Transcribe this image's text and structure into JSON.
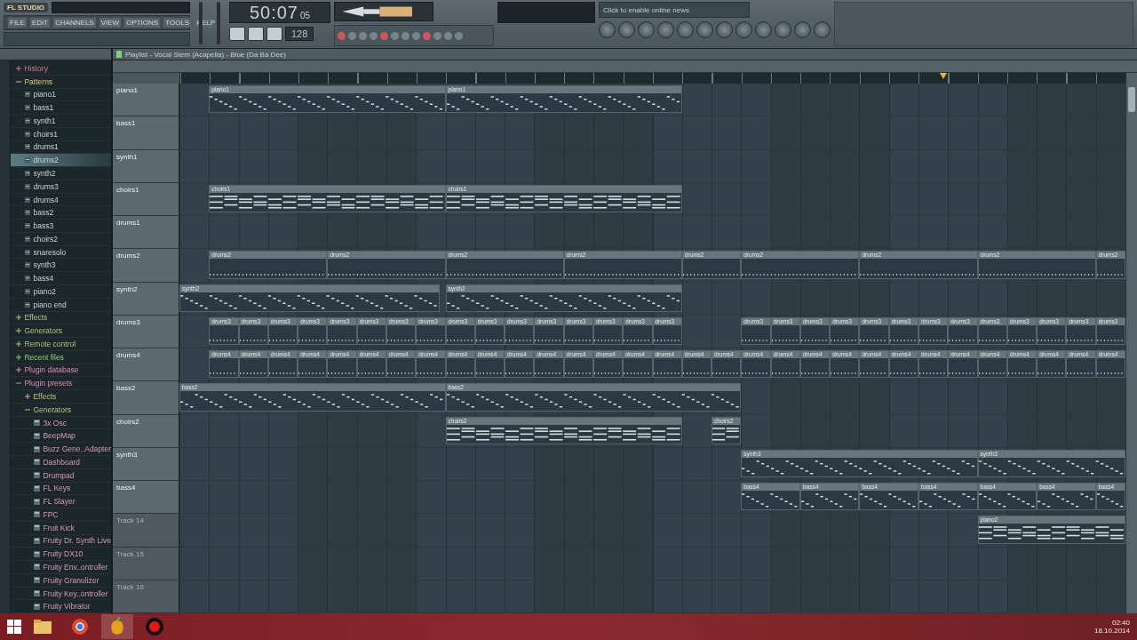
{
  "toolbar": {
    "logo": "FL STUDIO",
    "menu": [
      {
        "label": "FILE"
      },
      {
        "label": "EDIT"
      },
      {
        "label": "CHANNELS"
      },
      {
        "label": "VIEW"
      },
      {
        "label": "OPTIONS"
      },
      {
        "label": "TOOLS"
      },
      {
        "label": "HELP"
      }
    ],
    "time": "50:07",
    "frames": "05",
    "tempo": "128",
    "news_hint": "Click to enable online news"
  },
  "playlist": {
    "title": "Playlist - Vocal Stem (Acapella) - Blue (Da Ba Dee)",
    "tracks": [
      {
        "name": "piano1",
        "kind": "melody",
        "dimmed": false,
        "clips": [
          {
            "name": "piano1"
          },
          {
            "name": "piano1"
          }
        ]
      },
      {
        "name": "bass1",
        "dimmed": false
      },
      {
        "name": "synth1",
        "dimmed": false
      },
      {
        "name": "choirs1",
        "kind": "chords",
        "dimmed": false,
        "clips": [
          {
            "name": "choirs1"
          },
          {
            "name": "choirs1"
          }
        ]
      },
      {
        "name": "drums1",
        "dimmed": false
      },
      {
        "name": "drums2",
        "kind": "beat",
        "dimmed": false,
        "clips": [
          {
            "name": "drums2"
          },
          {
            "name": "drums2"
          },
          {
            "name": "drums2"
          },
          {
            "name": "drums2"
          },
          {
            "name": "drums2"
          },
          {
            "name": "drums2"
          },
          {
            "name": "drums2"
          },
          {
            "name": "drums2"
          },
          {
            "name": "drums2"
          }
        ]
      },
      {
        "name": "synth2",
        "kind": "melody",
        "dimmed": false,
        "clips": [
          {
            "name": "synth2"
          },
          {
            "name": "synth2"
          }
        ]
      },
      {
        "name": "drums3",
        "kind": "beat",
        "dimmed": false,
        "clips": [
          {
            "name": "drums3"
          },
          {
            "name": "drums3"
          },
          {
            "name": "drums3"
          },
          {
            "name": "drums3"
          },
          {
            "name": "drums3"
          },
          {
            "name": "drums3"
          },
          {
            "name": "drums3"
          },
          {
            "name": "drums3"
          },
          {
            "name": "drums3"
          },
          {
            "name": "drums3"
          },
          {
            "name": "drums3"
          },
          {
            "name": "drums3"
          },
          {
            "name": "drums3"
          },
          {
            "name": "drums3"
          },
          {
            "name": "drums3"
          },
          {
            "name": "drums3"
          },
          {
            "name": "drums3"
          },
          {
            "name": "drums3"
          },
          {
            "name": "drums3"
          },
          {
            "name": "drums3"
          },
          {
            "name": "drums3"
          },
          {
            "name": "drums3"
          },
          {
            "name": "drums3"
          },
          {
            "name": "drums3"
          },
          {
            "name": "drums3"
          },
          {
            "name": "drums3"
          },
          {
            "name": "drums3"
          },
          {
            "name": "drums3"
          },
          {
            "name": "drums3"
          }
        ]
      },
      {
        "name": "drums4",
        "kind": "beat",
        "dimmed": false,
        "clips": [
          {
            "name": "drums4"
          },
          {
            "name": "drums4"
          },
          {
            "name": "drums4"
          },
          {
            "name": "drums4"
          },
          {
            "name": "drums4"
          },
          {
            "name": "drums4"
          },
          {
            "name": "drums4"
          },
          {
            "name": "drums4"
          },
          {
            "name": "drums4"
          },
          {
            "name": "drums4"
          },
          {
            "name": "drums4"
          },
          {
            "name": "drums4"
          },
          {
            "name": "drums4"
          },
          {
            "name": "drums4"
          },
          {
            "name": "drums4"
          },
          {
            "name": "drums4"
          },
          {
            "name": "drums4"
          },
          {
            "name": "drums4"
          },
          {
            "name": "drums4"
          },
          {
            "name": "drums4"
          },
          {
            "name": "drums4"
          },
          {
            "name": "drums4"
          },
          {
            "name": "drums4"
          },
          {
            "name": "drums4"
          },
          {
            "name": "drums4"
          },
          {
            "name": "drums4"
          },
          {
            "name": "drums4"
          },
          {
            "name": "drums4"
          },
          {
            "name": "drums4"
          },
          {
            "name": "drums4"
          },
          {
            "name": "drums4"
          }
        ]
      },
      {
        "name": "bass2",
        "kind": "melody",
        "dimmed": false,
        "clips": [
          {
            "name": "bass2"
          },
          {
            "name": "bass2"
          }
        ]
      },
      {
        "name": "choirs2",
        "kind": "chords",
        "dimmed": false,
        "clips": [
          {
            "name": "choirs2"
          },
          {
            "name": "choirs2"
          }
        ]
      },
      {
        "name": "synth3",
        "kind": "melody",
        "dimmed": false,
        "clips": [
          {
            "name": "synth3"
          },
          {
            "name": "synth3"
          }
        ]
      },
      {
        "name": "bass4",
        "kind": "melody",
        "dimmed": false,
        "clips": [
          {
            "name": "bass4"
          },
          {
            "name": "bass4"
          },
          {
            "name": "bass4"
          },
          {
            "name": "bass4"
          },
          {
            "name": "bass4"
          },
          {
            "name": "bass4"
          },
          {
            "name": "bass4"
          }
        ]
      },
      {
        "name": "Track 14",
        "kind": "chords",
        "dimmed": true,
        "clips": [
          {
            "name": "piano2"
          }
        ]
      },
      {
        "name": "Track 15",
        "dimmed": true
      },
      {
        "name": "Track 16",
        "dimmed": true
      }
    ]
  },
  "browser": {
    "items": [
      {
        "label": "History",
        "kind": "history",
        "expanded": false,
        "selected": false
      },
      {
        "label": "Patterns",
        "kind": "patterns",
        "expanded": true,
        "selected": false,
        "children": [
          {
            "label": "piano1",
            "kind": "pattern",
            "selected": false
          },
          {
            "label": "bass1",
            "kind": "pattern",
            "selected": false
          },
          {
            "label": "synth1",
            "kind": "pattern",
            "selected": false
          },
          {
            "label": "choirs1",
            "kind": "pattern",
            "selected": false
          },
          {
            "label": "drums1",
            "kind": "pattern",
            "selected": false
          },
          {
            "label": "drums2",
            "kind": "pattern",
            "selected": true
          },
          {
            "label": "synth2",
            "kind": "pattern",
            "selected": false
          },
          {
            "label": "drums3",
            "kind": "pattern",
            "selected": false
          },
          {
            "label": "drums4",
            "kind": "pattern",
            "selected": false
          },
          {
            "label": "bass2",
            "kind": "pattern",
            "selected": false
          },
          {
            "label": "bass3",
            "kind": "pattern",
            "selected": false
          },
          {
            "label": "choirs2",
            "kind": "pattern",
            "selected": false
          },
          {
            "label": "snaresolo",
            "kind": "pattern",
            "selected": false
          },
          {
            "label": "synth3",
            "kind": "pattern",
            "selected": false
          },
          {
            "label": "bass4",
            "kind": "pattern",
            "selected": false
          },
          {
            "label": "piano2",
            "kind": "pattern",
            "selected": false
          },
          {
            "label": "piano end",
            "kind": "pattern",
            "selected": false
          }
        ]
      },
      {
        "label": "Effects",
        "kind": "folder",
        "expanded": false,
        "selected": false
      },
      {
        "label": "Generators",
        "kind": "folder",
        "expanded": false,
        "selected": false
      },
      {
        "label": "Remote control",
        "kind": "folder",
        "expanded": false,
        "selected": false
      },
      {
        "label": "Recent files",
        "kind": "recent",
        "expanded": false,
        "selected": false
      },
      {
        "label": "Plugin database",
        "kind": "database",
        "expanded": false,
        "selected": false
      },
      {
        "label": "Plugin presets",
        "kind": "database",
        "expanded": true,
        "selected": false,
        "children": [
          {
            "label": "Effects",
            "kind": "folder",
            "expanded": false,
            "selected": false
          },
          {
            "label": "Generators",
            "kind": "folder",
            "expanded": true,
            "selected": false,
            "children": [
              {
                "label": "3x Osc",
                "kind": "plugin",
                "selected": false
              },
              {
                "label": "BeepMap",
                "kind": "plugin",
                "selected": false
              },
              {
                "label": "Buzz Gene..Adapter",
                "kind": "plugin",
                "selected": false
              },
              {
                "label": "Dashboard",
                "kind": "plugin",
                "selected": false
              },
              {
                "label": "Drumpad",
                "kind": "plugin",
                "selected": false
              },
              {
                "label": "FL Keys",
                "kind": "plugin",
                "selected": false
              },
              {
                "label": "FL Slayer",
                "kind": "plugin",
                "selected": false
              },
              {
                "label": "FPC",
                "kind": "plugin",
                "selected": false
              },
              {
                "label": "Fruit Kick",
                "kind": "plugin",
                "selected": false
              },
              {
                "label": "Fruity Dr. Synth Live",
                "kind": "plugin",
                "selected": false
              },
              {
                "label": "Fruity DX10",
                "kind": "plugin",
                "selected": false
              },
              {
                "label": "Fruity Env..ontroller",
                "kind": "plugin",
                "selected": false
              },
              {
                "label": "Fruity Granulizer",
                "kind": "plugin",
                "selected": false
              },
              {
                "label": "Fruity Key..ontroller",
                "kind": "plugin",
                "selected": false
              },
              {
                "label": "Fruity Vibrator",
                "kind": "plugin",
                "selected": false
              }
            ]
          }
        ]
      }
    ]
  },
  "taskbar": {
    "apps": [
      {
        "kind": "folder"
      },
      {
        "kind": "browser"
      },
      {
        "kind": "fl"
      },
      {
        "kind": "record"
      }
    ],
    "clock": "02:40",
    "date": "18.10.2014"
  }
}
